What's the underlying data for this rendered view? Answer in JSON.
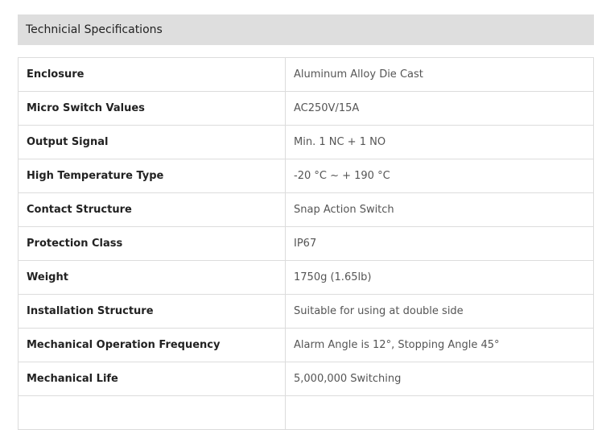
{
  "section": {
    "title": "Technicial Specifications"
  },
  "specs": [
    {
      "label": "Enclosure",
      "value": "Aluminum Alloy Die Cast"
    },
    {
      "label": "Micro Switch Values",
      "value": "AC250V/15A"
    },
    {
      "label": "Output Signal",
      "value": "Min. 1 NC + 1 NO"
    },
    {
      "label": "High Temperature Type",
      "value": "-20 °C ~ + 190 °C"
    },
    {
      "label": "Contact Structure",
      "value": "Snap Action Switch"
    },
    {
      "label": "Protection Class",
      "value": "IP67"
    },
    {
      "label": "Weight",
      "value": "1750g (1.65lb)"
    },
    {
      "label": "Installation Structure",
      "value": "Suitable for using at double side"
    },
    {
      "label": "Mechanical Operation Frequency",
      "value": "Alarm Angle is 12°,  Stopping Angle 45°"
    },
    {
      "label": "Mechanical Life",
      "value": "5,000,000 Switching"
    },
    {
      "label": "",
      "value": ""
    }
  ],
  "colors": {
    "header_bg": "#dedede",
    "border": "#dcdcdc"
  }
}
